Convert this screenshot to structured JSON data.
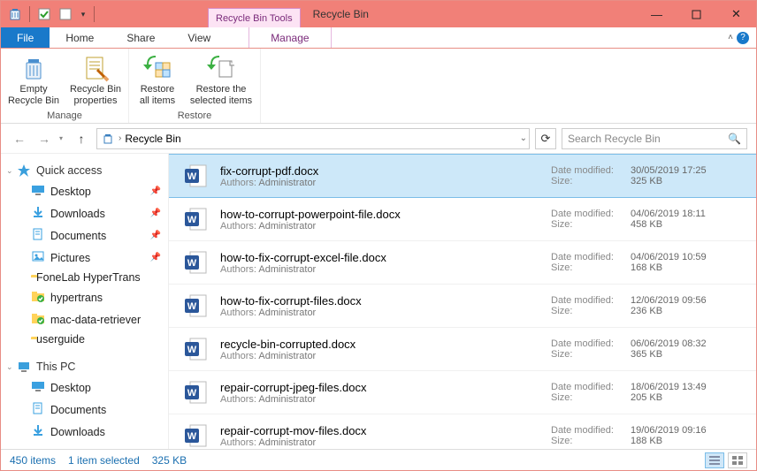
{
  "window": {
    "tool_tab": "Recycle Bin Tools",
    "title": "Recycle Bin"
  },
  "tabs": {
    "file": "File",
    "home": "Home",
    "share": "Share",
    "view": "View",
    "manage": "Manage"
  },
  "ribbon": {
    "empty": "Empty Recycle Bin",
    "properties": "Recycle Bin properties",
    "restore_all": "Restore all items",
    "restore_sel": "Restore the selected items",
    "group_manage": "Manage",
    "group_restore": "Restore"
  },
  "breadcrumb": {
    "location": "Recycle Bin"
  },
  "search": {
    "placeholder": "Search Recycle Bin"
  },
  "sidebar": {
    "quick_access": "Quick access",
    "this_pc": "This PC",
    "items": [
      {
        "label": "Desktop",
        "pinned": true,
        "icon": "desktop"
      },
      {
        "label": "Downloads",
        "pinned": true,
        "icon": "downloads"
      },
      {
        "label": "Documents",
        "pinned": true,
        "icon": "documents"
      },
      {
        "label": "Pictures",
        "pinned": true,
        "icon": "pictures"
      },
      {
        "label": "FoneLab HyperTrans",
        "pinned": false,
        "icon": "folder"
      },
      {
        "label": "hypertrans",
        "pinned": false,
        "icon": "folder-green"
      },
      {
        "label": "mac-data-retriever",
        "pinned": false,
        "icon": "folder-green"
      },
      {
        "label": "userguide",
        "pinned": false,
        "icon": "folder"
      }
    ],
    "pc_items": [
      {
        "label": "Desktop",
        "icon": "desktop"
      },
      {
        "label": "Documents",
        "icon": "documents"
      },
      {
        "label": "Downloads",
        "icon": "downloads"
      }
    ]
  },
  "labels": {
    "authors": "Authors:",
    "administrator": "Administrator",
    "date_modified": "Date modified:",
    "size": "Size:"
  },
  "files": [
    {
      "name": "fix-corrupt-pdf.docx",
      "date": "30/05/2019 17:25",
      "size": "325 KB",
      "selected": true
    },
    {
      "name": "how-to-corrupt-powerpoint-file.docx",
      "date": "04/06/2019 18:11",
      "size": "458 KB",
      "selected": false
    },
    {
      "name": "how-to-fix-corrupt-excel-file.docx",
      "date": "04/06/2019 10:59",
      "size": "168 KB",
      "selected": false
    },
    {
      "name": "how-to-fix-corrupt-files.docx",
      "date": "12/06/2019 09:56",
      "size": "236 KB",
      "selected": false
    },
    {
      "name": "recycle-bin-corrupted.docx",
      "date": "06/06/2019 08:32",
      "size": "365 KB",
      "selected": false
    },
    {
      "name": "repair-corrupt-jpeg-files.docx",
      "date": "18/06/2019 13:49",
      "size": "205 KB",
      "selected": false
    },
    {
      "name": "repair-corrupt-mov-files.docx",
      "date": "19/06/2019 09:16",
      "size": "188 KB",
      "selected": false
    }
  ],
  "status": {
    "items": "450 items",
    "selected": "1 item selected",
    "sel_size": "325 KB"
  }
}
